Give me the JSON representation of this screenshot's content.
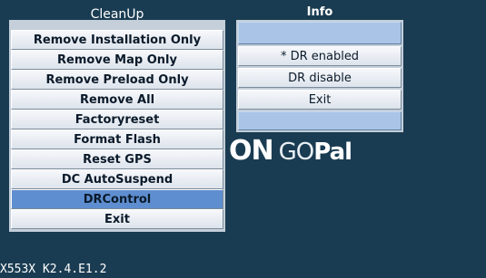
{
  "left_panel": {
    "title": "CleanUp",
    "items": [
      {
        "label": "Remove Installation Only"
      },
      {
        "label": "Remove Map Only"
      },
      {
        "label": "Remove Preload Only"
      },
      {
        "label": "Remove All"
      },
      {
        "label": "Factoryreset"
      },
      {
        "label": "Format Flash"
      },
      {
        "label": "Reset GPS"
      },
      {
        "label": "DC AutoSuspend"
      },
      {
        "label": "DRControl",
        "selected": true
      },
      {
        "label": "Exit"
      }
    ]
  },
  "right_panel": {
    "title": "Info",
    "items": [
      {
        "label": ""
      },
      {
        "label": "* DR enabled"
      },
      {
        "label": "DR disable"
      },
      {
        "label": "Exit"
      },
      {
        "label": ""
      }
    ]
  },
  "logo": {
    "left": "ON",
    "go": "GO",
    "pal": "Pal"
  },
  "version": "X553X K2.4.E1.2",
  "colors": {
    "background": "#1a3c52",
    "selected": "#5e8ed0",
    "button": "#e6ebf1",
    "blank_row": "#a9c4e6"
  }
}
